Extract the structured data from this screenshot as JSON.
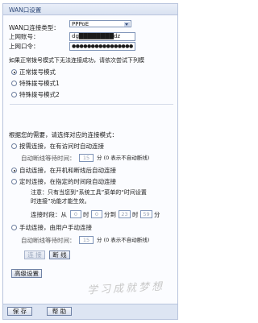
{
  "window": {
    "title": "WAN口设置"
  },
  "wan": {
    "type_label": "WAN口连接类型：",
    "type_value": "PPPoE",
    "account_label": "上网账号：",
    "account_value": "dg████████dz",
    "password_label": "上网口令：",
    "password_value": "●●●●●●●●●●●●●●●●"
  },
  "dial_modes": {
    "note": "如果正常拨号模式下无法连接成功，请依次尝试下列模",
    "options": [
      "正常拨号模式",
      "特殊拨号模式1",
      "特殊拨号模式2"
    ],
    "selected_index": 0
  },
  "connect_modes": {
    "note": "根据您的需要，请选择对应的连接模式：",
    "on_demand": {
      "label": "按需连接，在有访问时自动连接",
      "idle_prefix": "自动断线等待时间：",
      "idle_value": "15",
      "idle_suffix": "分 (0 表示不自动断线)"
    },
    "auto": {
      "label": "自动连接，在开机和断线后自动连接"
    },
    "timed": {
      "label": "定时连接，在指定的时间段自动连接",
      "note_line1": "注意：只有当您到“系统工具”菜单的“时间设置",
      "note_line2": "时连接”功能才能生效。",
      "period_prefix": "连接时段：从",
      "from_hour": "0",
      "hour_unit": "时",
      "from_min": "0",
      "to_word": "分到",
      "to_hour": "23",
      "to_min": "59",
      "min_unit": "分"
    },
    "manual": {
      "label": "手动连接，由用户手动连接",
      "idle_prefix": "自动断线等待时间：",
      "idle_value": "15",
      "idle_suffix": "分 (0 表示不自动断线)"
    },
    "selected": "auto"
  },
  "buttons": {
    "connect": "连 接",
    "disconnect": "断 线",
    "advanced": "高级设置",
    "save": "保 存",
    "help": "帮 助"
  },
  "watermark": "学习成就梦想"
}
